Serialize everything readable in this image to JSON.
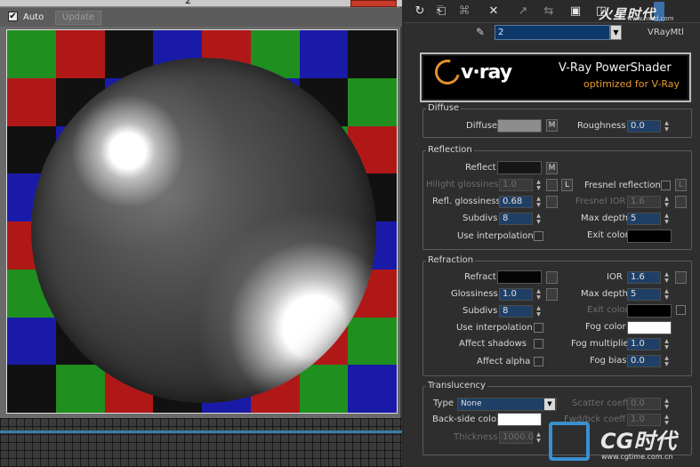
{
  "preview": {
    "title": "2",
    "auto_label": "Auto",
    "auto_checked": "✔",
    "update_label": "Update",
    "checker_colors": [
      "#1f8f1f",
      "#1a1aa8",
      "#111111",
      "#a5a5a5",
      "#b01818",
      "#1f8f1f",
      "#1a1aa8",
      "#111111"
    ]
  },
  "toolbar": {
    "icons": [
      "get-material-icon",
      "put-material-icon",
      "assign-icon",
      "delete-icon",
      "make-unique-icon",
      "put-to-library-icon",
      "material-id-icon",
      "show-map-icon",
      "show-end-result-icon"
    ],
    "watermark_text": "火星时代",
    "watermark_url": "www.hxsd.com"
  },
  "material": {
    "name": "2",
    "type": "VRayMtl"
  },
  "banner": {
    "logo_text": "v·ray",
    "title": "V-Ray PowerShader",
    "subtitle": "optimized for V-Ray"
  },
  "diffuse": {
    "group": "Diffuse",
    "diffuse_label": "Diffuse",
    "diffuse_color": "#8d8d8d",
    "map_btn": "M",
    "roughness_label": "Roughness",
    "roughness_value": "0.0"
  },
  "reflection": {
    "group": "Reflection",
    "reflect_label": "Reflect",
    "reflect_color": "#161616",
    "map_btn": "M",
    "hilight_label": "Hilight glossiness",
    "hilight_value": "1.0",
    "lock_btn": "L",
    "fresnel_label": "Fresnel reflections",
    "fresnel_lock": "L",
    "refl_gloss_label": "Refl. glossiness",
    "refl_gloss_value": "0.68",
    "fresnel_ior_label": "Fresnel IOR",
    "fresnel_ior_value": "1.6",
    "subdivs_label": "Subdivs",
    "subdivs_value": "8",
    "max_depth_label": "Max depth",
    "max_depth_value": "5",
    "interp_label": "Use interpolation",
    "exit_color_label": "Exit color",
    "exit_color": "#000000"
  },
  "refraction": {
    "group": "Refraction",
    "refract_label": "Refract",
    "refract_color": "#050505",
    "ior_label": "IOR",
    "ior_value": "1.6",
    "gloss_label": "Glossiness",
    "gloss_value": "1.0",
    "max_depth_label": "Max depth",
    "max_depth_value": "5",
    "subdivs_label": "Subdivs",
    "subdivs_value": "8",
    "exit_color_label": "Exit color",
    "exit_color": "#000000",
    "interp_label": "Use interpolation",
    "fog_color_label": "Fog color",
    "fog_color": "#ffffff",
    "shadows_label": "Affect shadows",
    "fog_mult_label": "Fog multiplier",
    "fog_mult_value": "1.0",
    "alpha_label": "Affect alpha",
    "fog_bias_label": "Fog bias",
    "fog_bias_value": "0.0"
  },
  "translucency": {
    "group": "Translucency",
    "type_label": "Type",
    "type_value": "None",
    "scatter_label": "Scatter coeff",
    "scatter_value": "0.0",
    "backside_label": "Back-side color",
    "backside_color": "#ffffff",
    "fwd_label": "Fwd/bck coeff",
    "fwd_value": "1.0",
    "thickness_label": "Thickness",
    "thickness_value": "1000.0"
  },
  "watermark_bottom": {
    "brand": "CG时代",
    "url": "www.cgtime.com.cn"
  }
}
